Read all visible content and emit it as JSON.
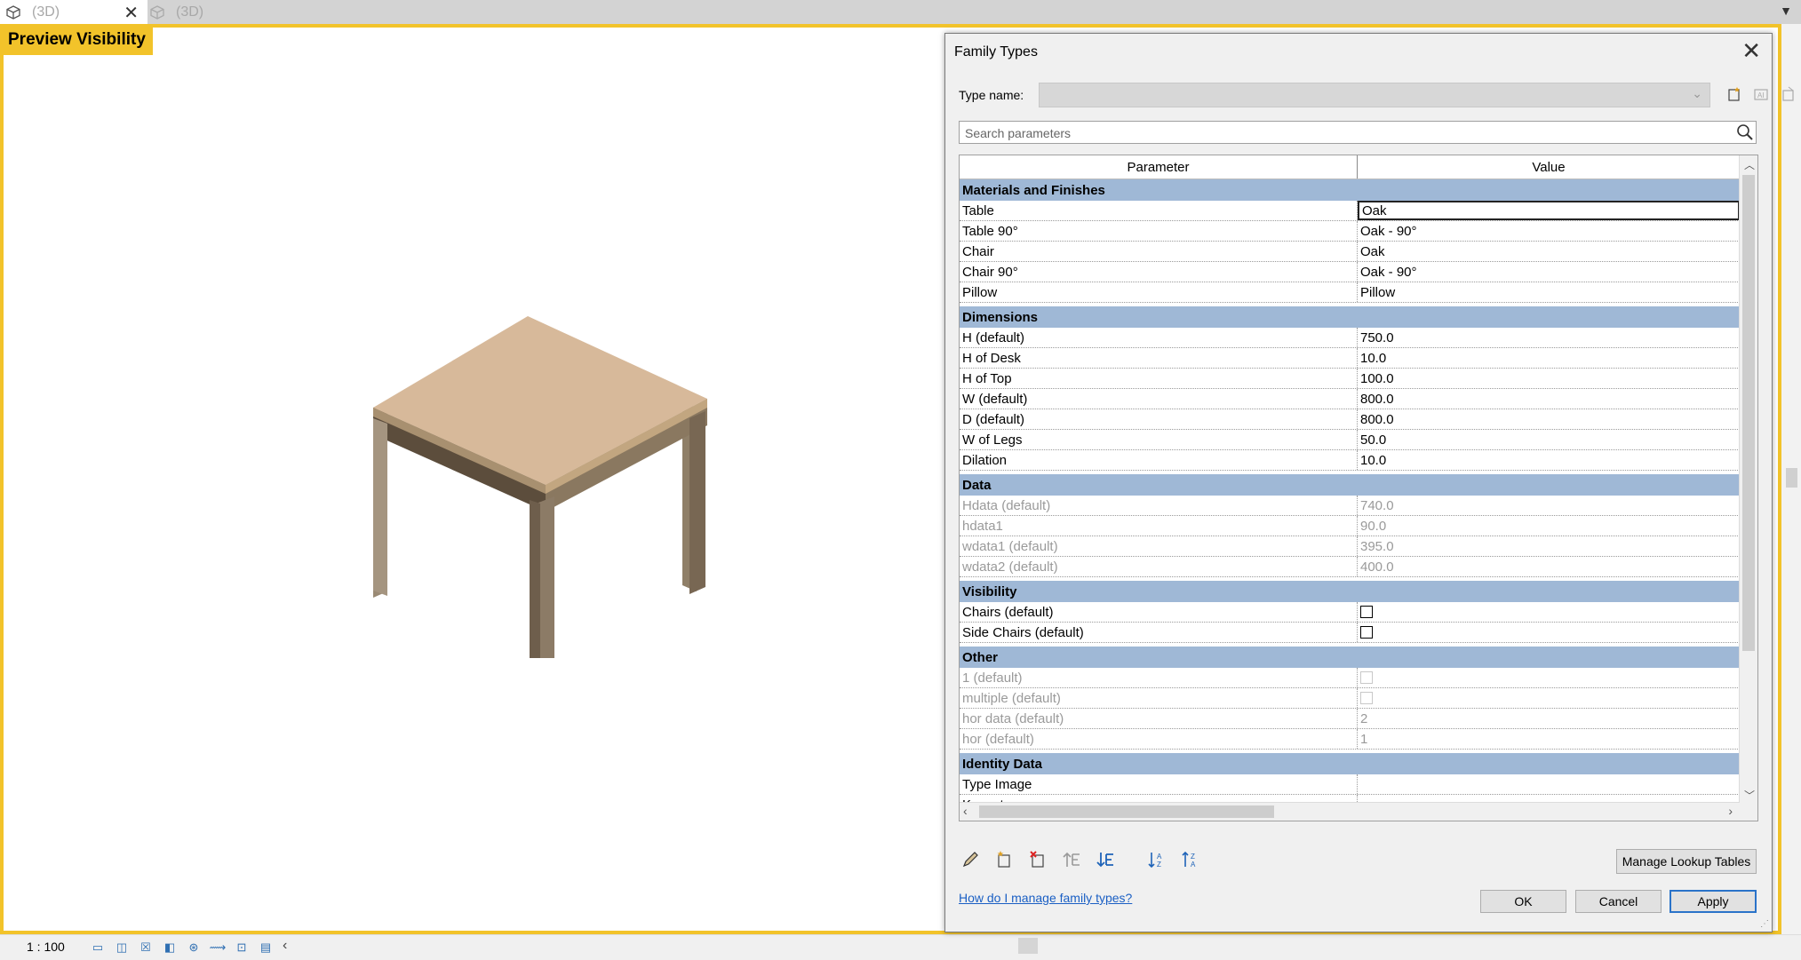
{
  "tabs": [
    {
      "label": "(3D)",
      "active": true
    },
    {
      "label": "(3D)",
      "active": false
    }
  ],
  "viewport": {
    "preview_label": "Preview Visibility",
    "scale": "1 : 100",
    "accent_color": "#f2c32a"
  },
  "dialog": {
    "title": "Family Types",
    "type_name_label": "Type name:",
    "type_name_value": "",
    "search_placeholder": "Search parameters",
    "columns": {
      "parameter": "Parameter",
      "value": "Value"
    },
    "groups": [
      {
        "name": "Materials and Finishes",
        "rows": [
          {
            "param": "Table",
            "value": "Oak",
            "selected": true
          },
          {
            "param": "Table 90°",
            "value": "Oak - 90°"
          },
          {
            "param": "Chair",
            "value": "Oak"
          },
          {
            "param": "Chair 90°",
            "value": "Oak - 90°"
          },
          {
            "param": "Pillow",
            "value": "Pillow"
          }
        ]
      },
      {
        "name": "Dimensions",
        "rows": [
          {
            "param": "H (default)",
            "value": "750.0"
          },
          {
            "param": "H of Desk",
            "value": "10.0"
          },
          {
            "param": "H of Top",
            "value": "100.0"
          },
          {
            "param": "W (default)",
            "value": "800.0"
          },
          {
            "param": "D (default)",
            "value": "800.0"
          },
          {
            "param": "W of Legs",
            "value": "50.0"
          },
          {
            "param": "Dilation",
            "value": "10.0"
          }
        ]
      },
      {
        "name": "Data",
        "rows": [
          {
            "param": "Hdata (default)",
            "value": "740.0",
            "dim": true
          },
          {
            "param": "hdata1",
            "value": "90.0",
            "dim": true
          },
          {
            "param": "wdata1 (default)",
            "value": "395.0",
            "dim": true
          },
          {
            "param": "wdata2 (default)",
            "value": "400.0",
            "dim": true
          }
        ]
      },
      {
        "name": "Visibility",
        "rows": [
          {
            "param": "Chairs (default)",
            "checkbox": true,
            "checked": false
          },
          {
            "param": "Side Chairs (default)",
            "checkbox": true,
            "checked": false
          }
        ]
      },
      {
        "name": "Other",
        "rows": [
          {
            "param": "1 (default)",
            "checkbox": true,
            "checked": false,
            "dim": true
          },
          {
            "param": "multiple (default)",
            "checkbox": true,
            "checked": false,
            "dim": true
          },
          {
            "param": "hor data (default)",
            "value": "2",
            "dim": true
          },
          {
            "param": "hor (default)",
            "value": "1",
            "dim": true
          }
        ]
      },
      {
        "name": "Identity Data",
        "rows": [
          {
            "param": "Type Image",
            "value": ""
          },
          {
            "param": "Keynote",
            "value": ""
          }
        ]
      }
    ],
    "group_header_color": "#9fb8d6",
    "tools": [
      "edit-pencil-icon",
      "new-parameter-icon",
      "delete-parameter-icon",
      "move-up-icon",
      "move-down-icon",
      "sort-ascending-icon",
      "sort-descending-icon"
    ],
    "manage_lookup_label": "Manage Lookup Tables",
    "help_link": "How do I manage family types?",
    "ok_label": "OK",
    "cancel_label": "Cancel",
    "apply_label": "Apply"
  }
}
